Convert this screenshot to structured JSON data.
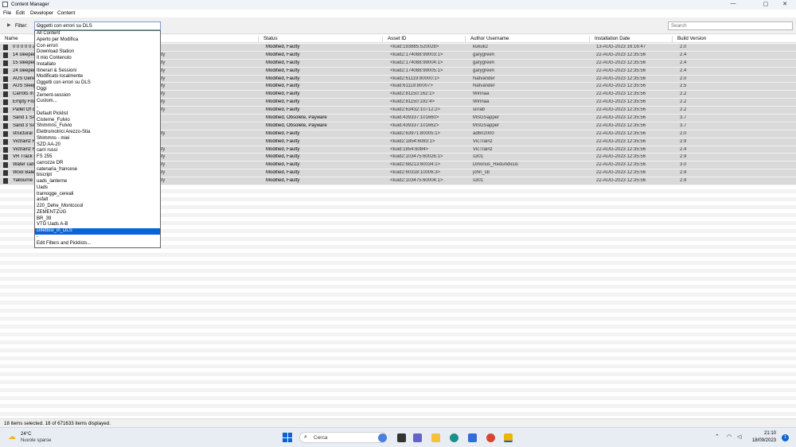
{
  "window": {
    "title": "Content Manager",
    "minimize": "—",
    "maximize": "▢",
    "close": "✕"
  },
  "menu": [
    "File",
    "Edit",
    "Developer",
    "Content"
  ],
  "filter": {
    "label": "Filter:",
    "selected": "Oggetti con errori su DLS",
    "search_placeholder": "Search"
  },
  "columns": [
    "Name",
    "Status",
    "Asset ID",
    "Author Username",
    "Installation Date",
    "Build Version"
  ],
  "rows": [
    {
      "name": "0 0 0 0 0 a",
      "type": "",
      "status": "Modified, Faulty",
      "id": "<kuid:193885:520028>",
      "author": "kukuk2",
      "date": "13-AUG-2023 16:16:47",
      "build": "2.0"
    },
    {
      "name": "14 sleeper",
      "type": "lity",
      "status": "Modified, Faulty",
      "id": "<kuid2:174088:99003:1>",
      "author": "garygreen",
      "date": "22-AUG-2023 12:35:56",
      "build": "2.4"
    },
    {
      "name": "15 sleeper",
      "type": "lity",
      "status": "Modified, Faulty",
      "id": "<kuid2:174088:99004:1>",
      "author": "garygreen",
      "date": "22-AUG-2023 12:35:56",
      "build": "2.4"
    },
    {
      "name": "24 sleeper",
      "type": "lity",
      "status": "Modified, Faulty",
      "id": "<kuid2:174088:99005:1>",
      "author": "garygreen",
      "date": "22-AUG-2023 12:35:56",
      "build": "2.4"
    },
    {
      "name": "AUS Gene",
      "type": "lity",
      "status": "Modified, Faulty",
      "id": "<kuid2:61119:80000:1>",
      "author": "Natvander",
      "date": "22-AUG-2023 12:35:56",
      "build": "2.0"
    },
    {
      "name": "AUS Sleep",
      "type": "lity",
      "status": "Modified, Faulty",
      "id": "<kuid:61119:80007>",
      "author": "Natvander",
      "date": "22-AUG-2023 12:35:56",
      "build": "2.5"
    },
    {
      "name": "Carrots in",
      "type": "lity",
      "status": "Modified, Faulty",
      "id": "<kuid2:81150:162:1>",
      "author": "Winnaa",
      "date": "22-AUG-2023 12:35:56",
      "build": "2.2"
    },
    {
      "name": "Empty Flo",
      "type": "lity",
      "status": "Modified, Faulty",
      "id": "<kuid2:81150:192:4>",
      "author": "Winnaa",
      "date": "22-AUG-2023 12:35:56",
      "build": "2.2"
    },
    {
      "name": "Pallet Of c",
      "type": "lity",
      "status": "Modified, Faulty",
      "id": "<kuid2:63432:10712:2>",
      "author": "sirrab",
      "date": "22-AUG-2023 12:35:56",
      "build": "2.2"
    },
    {
      "name": "Sand 1 SA",
      "type": "",
      "status": "Modified, Obsolete, Payware",
      "id": "<kuid:439337:101660>",
      "author": "MSGSapper",
      "date": "22-AUG-2023 12:35:56",
      "build": "3.7"
    },
    {
      "name": "Sand 3 SA",
      "type": "",
      "status": "Modified, Obsolete, Payware",
      "id": "<kuid:439337:101662>",
      "author": "MSGSapper",
      "date": "22-AUG-2023 12:35:56",
      "build": "3.7"
    },
    {
      "name": "structural",
      "type": "lity",
      "status": "Modified, Faulty",
      "id": "<kuid2:63971:80005:1>",
      "author": "ad602000",
      "date": "22-AUG-2023 12:35:56",
      "build": "2.0"
    },
    {
      "name": "Victrainz R",
      "type": "",
      "status": "Modified, Faulty",
      "id": "<kuid2:1854:6083:1>",
      "author": "VicTrainz",
      "date": "22-AUG-2023 12:35:56",
      "build": "2.9"
    },
    {
      "name": "Victrainz R",
      "type": "lity",
      "status": "Modified, Faulty",
      "id": "<kuid:1854:6084>",
      "author": "VicTrainz",
      "date": "22-AUG-2023 12:35:56",
      "build": "2.4"
    },
    {
      "name": "VR Track B",
      "type": "lity",
      "status": "Modified, Faulty",
      "id": "<kuid2:103475:60026:1>",
      "author": "s301",
      "date": "22-AUG-2023 12:35:56",
      "build": "2.9"
    },
    {
      "name": "Water can",
      "type": "lity",
      "status": "Modified, Faulty",
      "id": "<kuid2:68213:60034:1>",
      "author": "Dinorius_Redundicus",
      "date": "22-AUG-2023 12:35:56",
      "build": "3.0"
    },
    {
      "name": "Wool Bale",
      "type": "lity",
      "status": "Modified, Faulty",
      "id": "<kuid2:60318:10006:3>",
      "author": "john_sb",
      "date": "22-AUG-2023 12:35:56",
      "build": "2.9"
    },
    {
      "name": "Yallourne",
      "type": "lity",
      "status": "Modified, Faulty",
      "id": "<kuid2:103475:60004:1>",
      "author": "s301",
      "date": "22-AUG-2023 12:35:56",
      "build": "2.9"
    }
  ],
  "dropdown": [
    "All Content",
    "Aperto per Modifica",
    "Con errori",
    "Download Station",
    "Il mio Contenuto",
    "Installato",
    "Itinerari & Sessioni",
    "Modificato localmente",
    "Oggetti con errori su DLS",
    "Oggi",
    "Zement-session",
    "Custom...",
    "-",
    "Default Picklist",
    "Cisterne_Fulvio",
    "Shimmns_Fulvio",
    "Elettromotrici Arezzo-Stia",
    "Shimmns - miei",
    "SZD AA-20",
    "carri russi",
    "FS 255",
    "carrozze DR",
    "catenaria_francese",
    "biscript",
    "uads_lanterne",
    "Uads",
    "tramogge_cereali",
    "asfalt",
    "220_Dehe_Montcocol",
    "ZEMENTZUG",
    "BR_39",
    "VTG Uads A-B",
    "Difettosi_in_DLS",
    "-",
    "Edit Filters and Picklists..."
  ],
  "dropdown_selected": 32,
  "status": "18 items selected. 18 of 671633 items displayed.",
  "taskbar": {
    "temp": "24°C",
    "condition": "Nuvole sparse",
    "search": "Cerca",
    "time": "21:10",
    "date": "18/09/2023",
    "notifications": "1"
  }
}
